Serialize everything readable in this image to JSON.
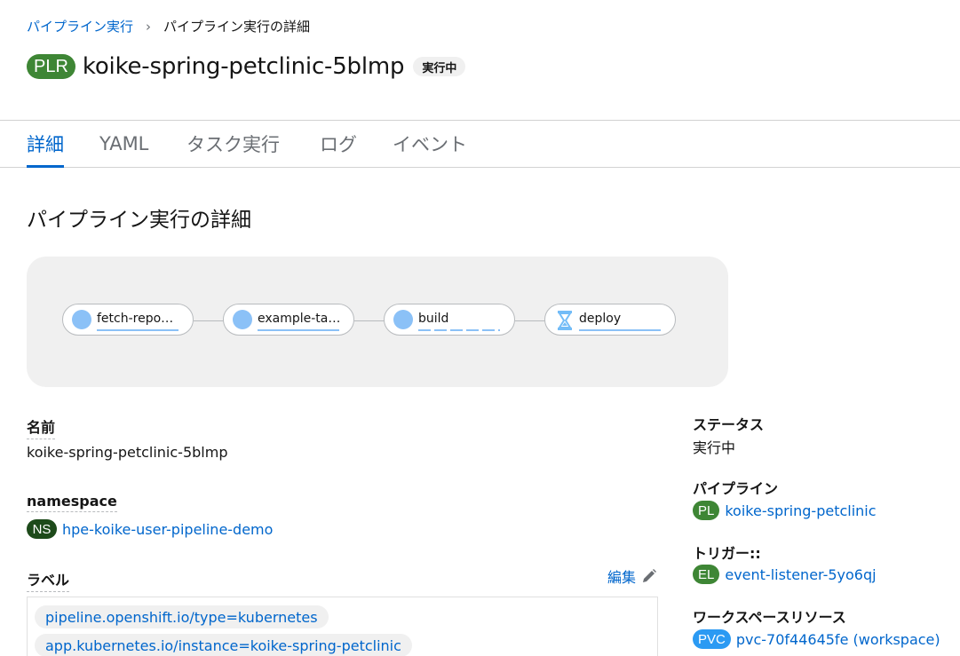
{
  "breadcrumb": {
    "parent": "パイプライン実行",
    "current": "パイプライン実行の詳細"
  },
  "header": {
    "badge": "PLR",
    "title": "koike-spring-petclinic-5blmp",
    "status": "実行中"
  },
  "tabs": [
    {
      "label": "詳細",
      "active": true
    },
    {
      "label": "YAML",
      "active": false
    },
    {
      "label": "タスク実行",
      "active": false
    },
    {
      "label": "ログ",
      "active": false
    },
    {
      "label": "イベント",
      "active": false
    }
  ],
  "section_title": "パイプライン実行の詳細",
  "pipeline_graph": {
    "tasks": [
      {
        "name": "fetch-repo…",
        "state": "running"
      },
      {
        "name": "example-ta…",
        "state": "running"
      },
      {
        "name": "build",
        "state": "running"
      },
      {
        "name": "deploy",
        "state": "pending"
      }
    ]
  },
  "details": {
    "name_label": "名前",
    "name_value": "koike-spring-petclinic-5blmp",
    "namespace_label": "namespace",
    "namespace_badge": "NS",
    "namespace_value": "hpe-koike-user-pipeline-demo",
    "labels_label": "ラベル",
    "edit_label": "編集",
    "labels": [
      "pipeline.openshift.io/type=kubernetes",
      "app.kubernetes.io/instance=koike-spring-petclinic"
    ]
  },
  "side": {
    "status_label": "ステータス",
    "status_value": "実行中",
    "pipeline_label": "パイプライン",
    "pipeline_badge": "PL",
    "pipeline_value": "koike-spring-petclinic",
    "trigger_label": "トリガー::",
    "trigger_badge": "EL",
    "trigger_value": "event-listener-5yo6qj",
    "workspace_label": "ワークスペースリソース",
    "workspace_badge": "PVC",
    "workspace_value": "pvc-70f44645fe (workspace)"
  },
  "colors": {
    "link": "#0066cc",
    "plr_badge": "#3e8635",
    "ns_badge": "#1d4a1a",
    "pvc_badge": "#2b9af3",
    "running": "#8bc1f7"
  }
}
